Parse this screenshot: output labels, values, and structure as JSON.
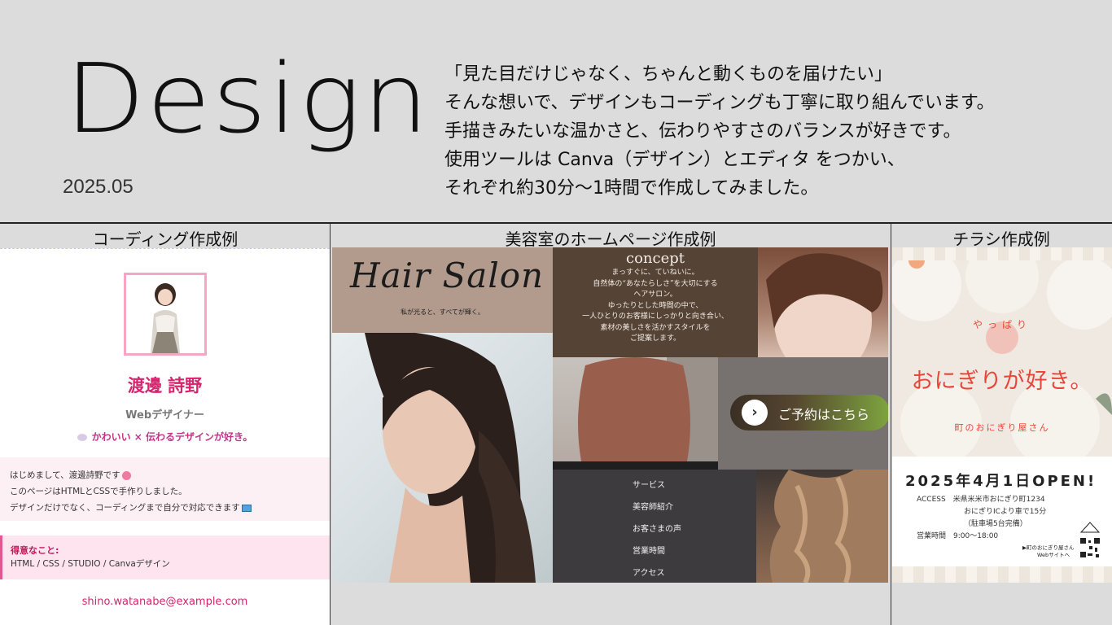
{
  "header": {
    "title": "Design",
    "date": "2025.05",
    "intro_lines": [
      "「見た目だけじゃなく、ちゃんと動くものを届けたい」",
      "そんな想いで、デザインもコーディングも丁寧に取り組んでいます。",
      "手描きみたいな温かさと、伝わりやすさのバランスが好きです。",
      "使用ツールは Canva（デザイン）とエディタ をつかい、",
      "それぞれ約30分〜1時間で作成してみました。"
    ]
  },
  "columns": {
    "coding_label": "コーディング作成例",
    "salon_label": "美容室のホームページ作成例",
    "flyer_label": "チラシ作成例"
  },
  "profile": {
    "name": "渡邊 詩野",
    "role": "Webデザイナー",
    "tagline": "かわいい × 伝わるデザインが好き。",
    "intro_line1": "はじめまして、渡邊詩野です",
    "intro_line2": "このページはHTMLとCSSで手作りしました。",
    "intro_line3": "デザインだけでなく、コーディングまで自分で対応できます",
    "skills_title": "得意なこと:",
    "skills_list": "HTML / CSS / STUDIO / Canvaデザイン",
    "email": "shino.watanabe@example.com"
  },
  "salon": {
    "logo_title": "Hair Salon",
    "logo_sub": "私が光ると、すべてが輝く。",
    "concept_title": "concept",
    "concept_lines": [
      "まっすぐに、ていねいに。",
      "自然体の“あなたらしさ”を大切にする",
      "ヘアサロン。",
      "ゆったりとした時間の中で、",
      "一人ひとりのお客様にしっかりと向き合い、",
      "素材の美しさを活かすスタイルを",
      "ご提案します。"
    ],
    "reserve_label": "ご予約はこちら",
    "menu": [
      "サービス",
      "美容師紹介",
      "お客さまの声",
      "営業時間",
      "アクセス"
    ]
  },
  "flyer": {
    "pre": "やっぱり",
    "title": "おにぎりが好き。",
    "shop": "町のおにぎり屋さん",
    "open": "2025年4月1日OPEN!",
    "access_line": "ACCESS　米県米米市おにぎり町1234",
    "access_line2": "おにぎりICより車で15分",
    "access_line3": "（駐車場5台完備）",
    "hours": "営業時間　9:00〜18:00",
    "link_line1": "▶町のおにぎり屋さん",
    "link_line2": "Webサイトへ"
  },
  "colors": {
    "accent_pink": "#d6246e",
    "flyer_red": "#e8453a",
    "salon_brown": "#554336",
    "page_bg": "#dcdcdc"
  }
}
